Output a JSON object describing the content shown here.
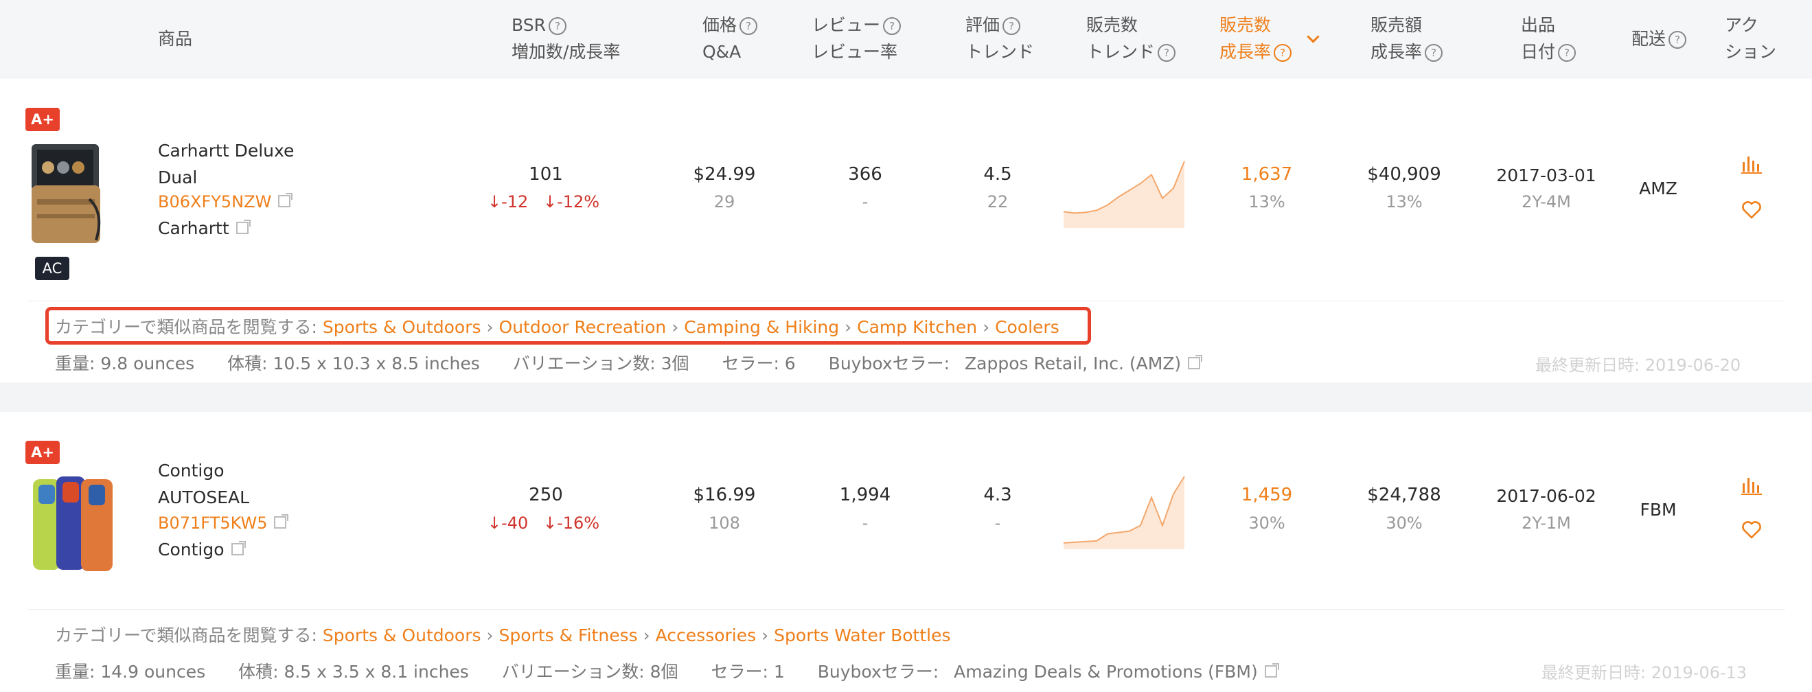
{
  "header": {
    "product": "商品",
    "bsr_l1": "BSR",
    "bsr_l2": "増加数/成長率",
    "price_l1": "価格",
    "price_l2": "Q&A",
    "review_l1": "レビュー",
    "review_l2": "レビュー率",
    "rating_l1": "評価",
    "rating_l2": "トレンド",
    "sales_l1": "販売数",
    "sales_l2": "トレンド",
    "growth_l1": "販売数",
    "growth_l2": "成長率",
    "revenue_l1": "販売額",
    "revenue_l2": "成長率",
    "listed_l1": "出品",
    "listed_l2": "日付",
    "shipping": "配送",
    "action_l1": "アク",
    "action_l2": "ション",
    "help_glyph": "?"
  },
  "colors": {
    "accent": "#ef7f1a",
    "down": "#d0342c",
    "badge": "#e8412b"
  },
  "products": [
    {
      "badge_top": "A+",
      "badge_bottom": "AC",
      "name_line1": "Carhartt Deluxe",
      "name_line2": "Dual",
      "asin": "B06XFY5NZW",
      "brand": "Carhartt",
      "bsr": "101",
      "bsr_change": "-12",
      "bsr_rate": "-12%",
      "price": "$24.99",
      "qa": "29",
      "reviews": "366",
      "review_rate": "-",
      "rating": "4.5",
      "rating_trend": "22",
      "sales_trend": [
        0.2,
        0.18,
        0.19,
        0.22,
        0.3,
        0.42,
        0.52,
        0.62,
        0.75,
        0.4,
        0.55,
        0.95
      ],
      "sales": "1,637",
      "sales_growth": "13%",
      "revenue": "$40,909",
      "revenue_growth": "13%",
      "listed_date": "2017-03-01",
      "listed_age": "2Y-4M",
      "shipping": "AMZ",
      "category_label": "カテゴリーで類似商品を閲覧する:",
      "categories": [
        "Sports & Outdoors",
        "Outdoor Recreation",
        "Camping & Hiking",
        "Camp Kitchen",
        "Coolers"
      ],
      "weight": "重量: 9.8 ounces",
      "size": "体積: 10.5 x 10.3 x 8.5 inches",
      "variations": "バリエーション数: 3個",
      "sellers": "セラー: 6",
      "buybox_label": "Buyboxセラー:",
      "buybox": "Zappos Retail, Inc. (AMZ)",
      "updated": "最終更新日時: 2019-06-20"
    },
    {
      "badge_top": "A+",
      "name_line1": "Contigo",
      "name_line2": "AUTOSEAL",
      "asin": "B071FT5KW5",
      "brand": "Contigo",
      "bsr": "250",
      "bsr_change": "-40",
      "bsr_rate": "-16%",
      "price": "$16.99",
      "qa": "108",
      "reviews": "1,994",
      "review_rate": "-",
      "rating": "4.3",
      "rating_trend": "-",
      "sales_trend": [
        0.05,
        0.06,
        0.07,
        0.08,
        0.18,
        0.2,
        0.22,
        0.3,
        0.7,
        0.3,
        0.75,
        1.0
      ],
      "sales": "1,459",
      "sales_growth": "30%",
      "revenue": "$24,788",
      "revenue_growth": "30%",
      "listed_date": "2017-06-02",
      "listed_age": "2Y-1M",
      "shipping": "FBM",
      "category_label": "カテゴリーで類似商品を閲覧する:",
      "categories": [
        "Sports & Outdoors",
        "Sports & Fitness",
        "Accessories",
        "Sports Water Bottles"
      ],
      "weight": "重量: 14.9 ounces",
      "size": "体積: 8.5 x 3.5 x 8.1 inches",
      "variations": "バリエーション数: 8個",
      "sellers": "セラー: 1",
      "buybox_label": "Buyboxセラー:",
      "buybox": "Amazing Deals & Promotions (FBM)",
      "updated": "最終更新日時: 2019-06-13"
    }
  ],
  "breadcrumb_separator": "›"
}
